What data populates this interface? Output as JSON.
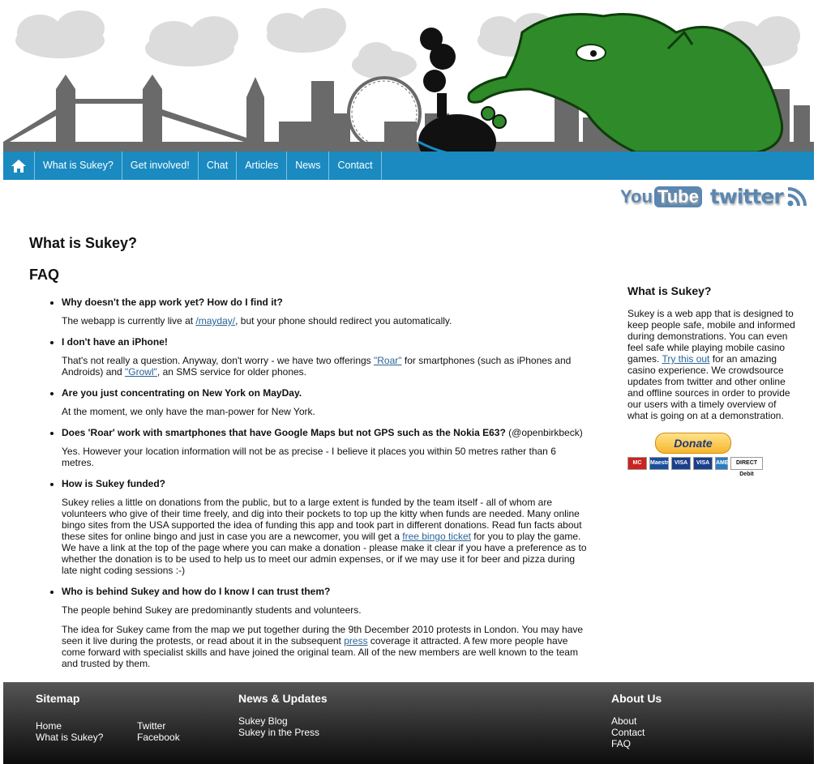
{
  "nav": {
    "items": [
      "What is Sukey?",
      "Get involved!",
      "Chat",
      "Articles",
      "News",
      "Contact"
    ]
  },
  "social": {
    "youtube_you": "You",
    "youtube_tube": "Tube",
    "twitter": "twitter"
  },
  "main": {
    "title": "What is Sukey?",
    "faq_heading": "FAQ",
    "faq": [
      {
        "q": "Why doesn't the app work yet? How do I find it?",
        "paras": [
          {
            "before": "The webapp is currently live at ",
            "link": "/mayday/",
            "after": ", but your phone should redirect you automatically."
          }
        ]
      },
      {
        "q": "I don't have an iPhone!",
        "paras": [
          {
            "before": "That's not really a question. Anyway, don't worry - we have two offerings ",
            "link": "\"Roar\"",
            "after": " for smartphones (such as iPhones and Androids) and ",
            "link2": "\"Growl\"",
            "after2": ", an SMS service for older phones."
          }
        ]
      },
      {
        "q": "Are you just concentrating on New York on MayDay.",
        "paras": [
          {
            "before": "At the moment, we only have the man-power for New York."
          }
        ]
      },
      {
        "q": "Does 'Roar' work with smartphones that have Google Maps but not GPS such as the Nokia E63?",
        "by": " (@openbirkbeck)",
        "paras": [
          {
            "before": "Yes. However your location information will not be as precise - I believe it places you within 50 metres rather than 6 metres."
          }
        ]
      },
      {
        "q": "How is Sukey funded?",
        "paras": [
          {
            "before": "Sukey relies a little on donations from the public, but to a large extent is funded by the team itself - all of whom are volunteers who give of their time freely, and dig into their pockets to top up the kitty when funds are needed. Many online bingo sites from the USA supported the idea of funding this app and took part in different donations. Read fun facts about these sites for online bingo and just in case you are a newcomer, you will get a ",
            "link": "free bingo ticket",
            "after": " for you to play the game. We have a link at the top of the page where you can make a donation - please make it clear if you have a preference as to whether the donation is to be used to help us to meet our admin expenses, or if we may use it for beer and pizza during late night coding sessions :-)"
          }
        ]
      },
      {
        "q": "Who is behind Sukey and how do I know I can trust them?",
        "paras": [
          {
            "before": "The people behind Sukey are predominantly students and volunteers."
          },
          {
            "before": "The idea for Sukey came from the map we put together during the 9th December 2010 protests in London. You may have seen it live during the protests, or read about it in the subsequent ",
            "link": "press",
            "after": " coverage it attracted. A few more people have come forward with specialist skills and have joined the original team. All of the new members are well known to the team and trusted by them."
          }
        ]
      }
    ]
  },
  "sidebar": {
    "title": "What is Sukey?",
    "text_before": "Sukey is a web app that is designed to keep people safe, mobile and informed during demonstrations. You can even feel safe while playing mobile casino games. ",
    "link": "Try this out",
    "text_after": " for an amazing casino experience. We crowdsource updates from twitter and other online and offline sources in order to provide our users with a timely overview of what is going on at a demonstration.",
    "donate_label": "Donate",
    "cards": [
      "MC",
      "Maestro",
      "VISA",
      "VISA",
      "AMEX",
      "DIRECT Debit"
    ]
  },
  "footer": {
    "sitemap": {
      "title": "Sitemap",
      "links_left": [
        "Home",
        "What is Sukey?"
      ],
      "links_right": [
        "Twitter",
        "Facebook"
      ]
    },
    "news": {
      "title": "News & Updates",
      "links": [
        "Sukey Blog",
        "Sukey in the Press"
      ]
    },
    "about": {
      "title": "About Us",
      "links": [
        "About",
        "Contact",
        "FAQ"
      ]
    }
  },
  "colors": {
    "nav": "#1a8ac1",
    "skyline": "#6a6a6a",
    "dragon": "#2f8a2a",
    "link": "#2a6496"
  }
}
